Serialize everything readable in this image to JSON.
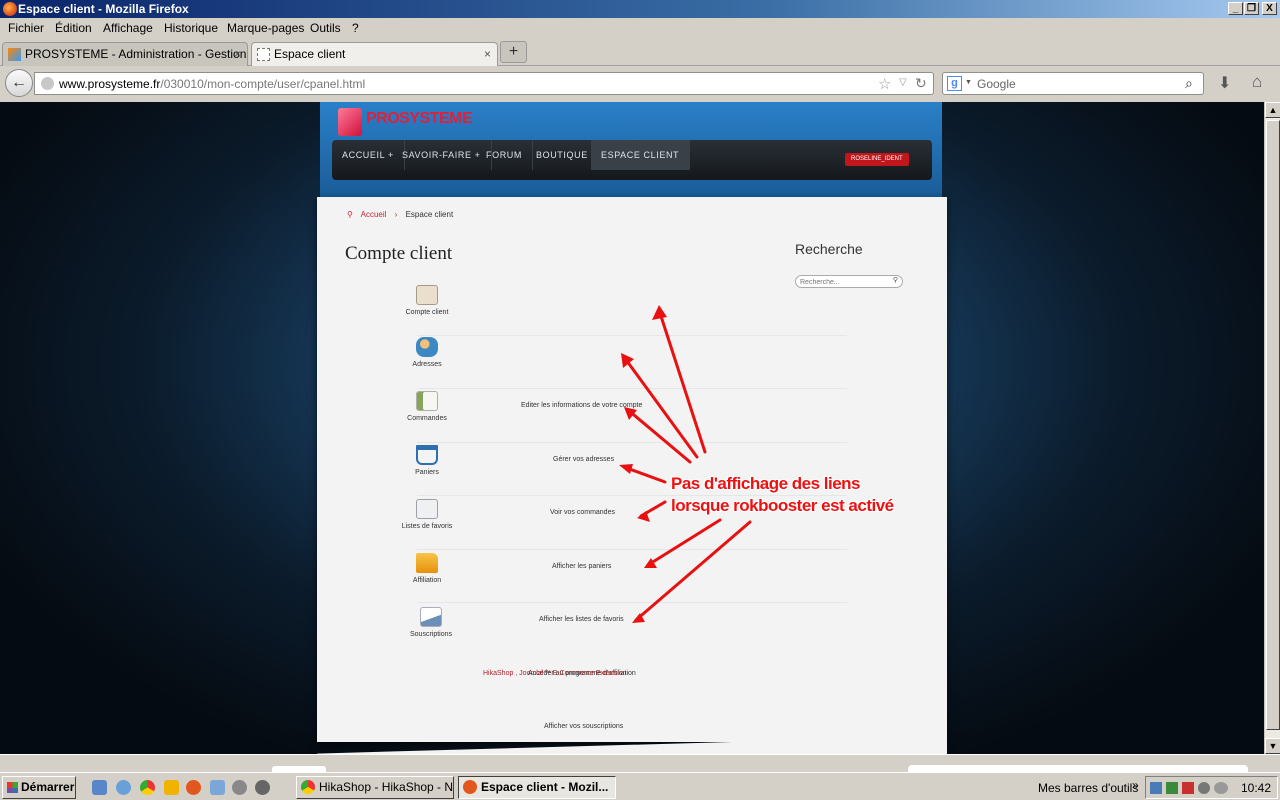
{
  "window": {
    "title": "Espace client - Mozilla Firefox",
    "minimize": "_",
    "maximize": "❐",
    "close": "X"
  },
  "menu": [
    "Fichier",
    "Édition",
    "Affichage",
    "Historique",
    "Marque-pages",
    "Outils",
    "?"
  ],
  "tabs": [
    {
      "label": "PROSYSTEME - Administration - Gestion ...",
      "close": "×"
    },
    {
      "label": "Espace client",
      "close": "×"
    }
  ],
  "newtab": "+",
  "nav": {
    "back": "←",
    "url_host": "www.prosysteme.fr",
    "url_path": "/030010/mon-compte/user/cpanel.html",
    "search_placeholder": "Google",
    "search_engine": "g"
  },
  "site": {
    "logo": "PROSYSTEME",
    "menu": [
      "ACCUEIL +",
      "SAVOIR-FAIRE +",
      "FORUM",
      "BOUTIQUE",
      "ESPACE CLIENT"
    ],
    "user_button": "ROSELINE_IDENT",
    "breadcrumb": {
      "home": "Accueil",
      "sep": "›",
      "current": "Espace client"
    },
    "page_title": "Compte client",
    "search_title": "Recherche",
    "search_placeholder": "Recherche...",
    "items": [
      {
        "label": "Compte client",
        "desc": "Editer les informations de votre compte",
        "color": "#c9a36b"
      },
      {
        "label": "Adresses",
        "desc": "Gérer vos adresses",
        "color": "#3b88c4"
      },
      {
        "label": "Commandes",
        "desc": "Voir vos commandes",
        "color": "#8aa35c"
      },
      {
        "label": "Paniers",
        "desc": "Afficher les paniers",
        "color": "#2f6fb0"
      },
      {
        "label": "Listes de favoris",
        "desc": "Afficher les listes de favoris",
        "color": "#9aa0a8"
      },
      {
        "label": "Affiliation",
        "desc": "Accéder au programme d'affiliation",
        "color": "#f0a020"
      },
      {
        "label": "Souscriptions",
        "desc": "Afficher vos souscriptions",
        "color": "#6c8fb8"
      }
    ],
    "footer_link": "HikaShop , Joomla!™ E-Commerce Extension"
  },
  "annotation": {
    "line1": "Pas d'affichage des liens",
    "line2": "lorsque rokbooster est activé",
    "color": "#ee1111"
  },
  "taskbar": {
    "start": "Démarrer",
    "tasks": [
      "HikaShop - HikaShop - N...",
      "Espace client - Mozil..."
    ],
    "toolbars": "Mes barres d'outils",
    "toolbars_chevron": "»",
    "clock": "10:42"
  }
}
